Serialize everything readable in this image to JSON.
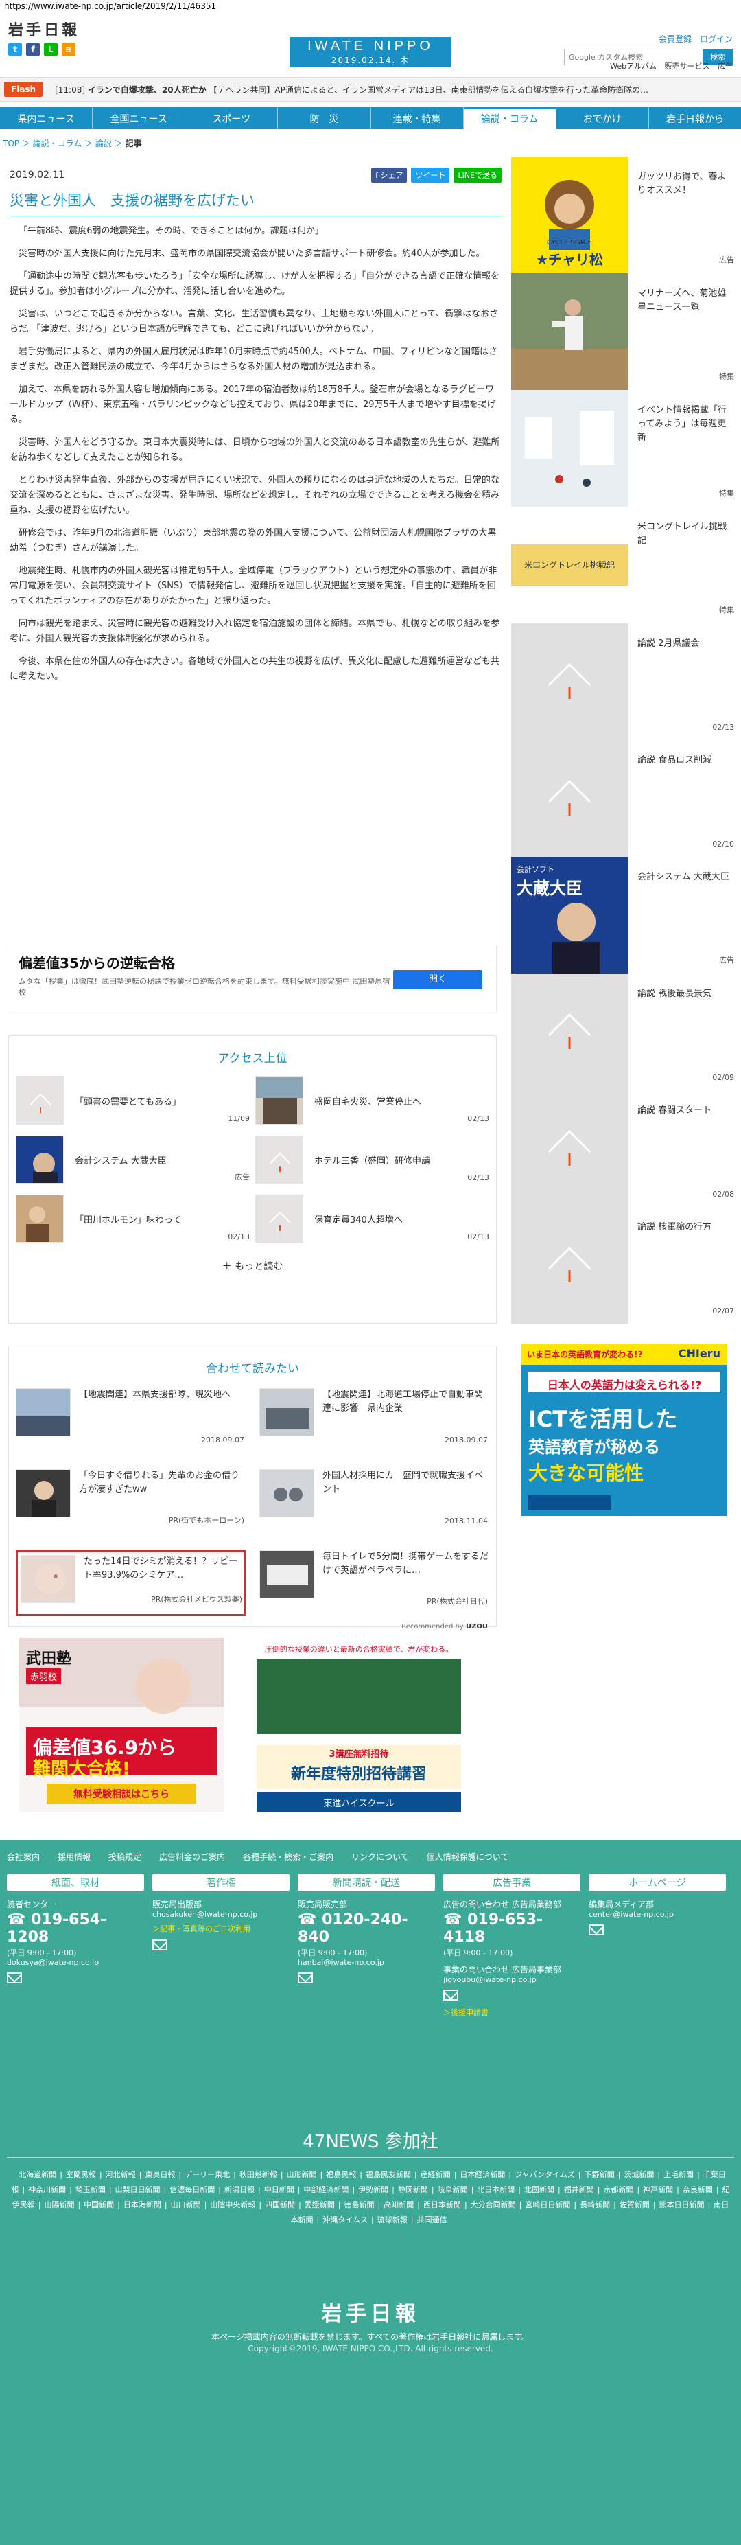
{
  "browser": {
    "url": "https://www.iwate-np.co.jp/article/2019/2/11/46351"
  },
  "header": {
    "logo_jp": "岩手日報",
    "logo_en": "IWATE NIPPO",
    "date": "2019.02.14. 木",
    "links": [
      "会員登録",
      "ログイン"
    ],
    "search_placeholder": "Google カスタム検索",
    "search_button": "検索",
    "sub_links": [
      "Webアルバム",
      "販売サービス",
      "広告"
    ]
  },
  "flash": {
    "tag": "Flash",
    "time": "[11:08]",
    "headline": "イランで自爆攻撃、20人死亡か",
    "detail": "【テヘラン共同】AP通信によると、イラン国営メディアは13日、南東部情勢を伝える自爆攻撃を行った革命防衛隊の…"
  },
  "nav": [
    {
      "label": "県内ニュース"
    },
    {
      "label": "全国ニュース"
    },
    {
      "label": "スポーツ"
    },
    {
      "label": "防　災"
    },
    {
      "label": "連載・特集"
    },
    {
      "label": "論説・コラム",
      "active": true
    },
    {
      "label": "おでかけ"
    },
    {
      "label": "岩手日報から"
    }
  ],
  "breadcrumb": {
    "path": "TOP ＞ 論説・コラム ＞ 論説 ＞",
    "current": "記事"
  },
  "article": {
    "date": "2019.02.11",
    "share_fb": "f シェア",
    "share_tw": "ツイート",
    "share_ln": "LINEで送る",
    "title": "災害と外国人　支援の裾野を広げたい",
    "paragraphs": [
      "「午前8時、震度6弱の地震発生。その時、できることは何か。課題は何か」",
      "災害時の外国人支援に向けた先月末、盛岡市の県国際交流協会が開いた多言語サポート研修会。約40人が参加した。",
      "「通勤途中の時間で観光客も歩いたろう」「安全な場所に誘導し、けが人を把握する」「自分ができる言語で正確な情報を提供する」。参加者は小グループに分かれ、活発に話し合いを進めた。",
      "災害は、いつどこで起きるか分からない。言葉、文化、生活習慣も異なり、土地勘もない外国人にとって、衝撃はなおさらだ。「津波だ、逃げろ」という日本語が理解できても、どこに逃げればいいか分からない。",
      "岩手労働局によると、県内の外国人雇用状況は昨年10月末時点で約4500人。ベトナム、中国、フィリピンなど国籍はさまざまだ。改正入管難民法の成立で、今年4月からはさらなる外国人材の増加が見込まれる。",
      "加えて、本県を訪れる外国人客も増加傾向にある。2017年の宿泊者数は約18万8千人。釜石市が会場となるラグビーワールドカップ（W杯）、東京五輪・パラリンピックなども控えており、県は20年までに、29万5千人まで増やす目標を掲げる。",
      "災害時、外国人をどう守るか。東日本大震災時には、日頃から地域の外国人と交流のある日本語教室の先生らが、避難所を訪ね歩くなどして支えたことが知られる。",
      "とりわけ災害発生直後、外部からの支援が届きにくい状況で、外国人の頼りになるのは身近な地域の人たちだ。日常的な交流を深めるとともに、さまざまな災害、発生時間、場所などを想定し、それぞれの立場でできることを考える機会を積み重ね、支援の裾野を広げたい。",
      "研修会では、昨年9月の北海道胆振（いぶり）東部地震の際の外国人支援について、公益財団法人札幌国際プラザの大黒幼希（つむぎ）さんが講演した。",
      "地震発生時、札幌市内の外国人観光客は推定約5千人。全域停電（ブラックアウト）という想定外の事態の中、職員が非常用電源を使い、会員制交流サイト（SNS）で情報発信し、避難所を巡回し状況把握と支援を実施。「自主的に避難所を回ってくれたボランティアの存在がありがたかった」と振り返った。",
      "同市は観光を踏まえ、災害時に観光客の避難受け入れ協定を宿泊施設の団体と締結。本県でも、札幌などの取り組みを参考に、外国人観光客の支援体制強化が求められる。",
      "今後、本県在住の外国人の存在は大きい。各地域で外国人との共生の視野を広げ、異文化に配慮した避難所運営なども共に考えたい。"
    ]
  },
  "ad_banner": {
    "headline": "偏差値35からの逆転合格",
    "desc": "ムダな「授業」は徹底！武田塾逆転の秘訣で授業ゼロ逆転合格を約束します。無料受験相談実施中 武田塾原宿校",
    "button": "開く"
  },
  "ranking": {
    "title": "アクセス上位",
    "items": [
      {
        "title": "「頭書の需要とてもある」",
        "date": "11/09"
      },
      {
        "title": "盛岡自宅火災、営業停止へ",
        "date": "02/13"
      },
      {
        "title": "会計システム 大蔵大臣",
        "date": "広告"
      },
      {
        "title": "ホテル三香（盛岡）研修申請",
        "date": "02/13"
      },
      {
        "title": "「田川ホルモン」味わって",
        "date": "02/13"
      },
      {
        "title": "保育定員340人超増へ",
        "date": "02/13"
      }
    ],
    "more": "＋ もっと読む"
  },
  "recommended": {
    "title": "合わせて読みたい",
    "items": [
      {
        "title": "【地震関連】本県支援部隊、現災地へ",
        "date": "2018.09.07"
      },
      {
        "title": "【地震関連】北海道工場停止で自動車関連に影響　県内企業",
        "date": "2018.09.07"
      },
      {
        "title": "「今日すぐ借りれる」先輩のお金の借り方が凄すぎたww",
        "date": "PR(街でもホーローン)"
      },
      {
        "title": "外国人材採用にカ　盛岡で就職支援イベント",
        "date": "2018.11.04"
      },
      {
        "title": "たった14日でシミが消える！？リピート率93.9%のシミケア…",
        "date": "PR(株式会社メビウス製薬)"
      },
      {
        "title": "毎日トイレで5分間！携帯ゲームをするだけで英語がペラペラに…",
        "date": "PR(株式会社日代)"
      }
    ],
    "recommended_by_label": "Recommended by",
    "recommended_by_brand": "UZOU"
  },
  "sidebar": {
    "items": [
      {
        "title": "ガッツリお得で、春よりオススメ！",
        "date": "広告"
      },
      {
        "title": "マリナーズへ、菊池雄星ニュース一覧",
        "date": "特集"
      },
      {
        "title": "イベント情報掲載「行ってみよう」は毎週更新",
        "date": "特集"
      },
      {
        "title": "米ロングトレイル挑戦記",
        "date": "特集"
      },
      {
        "title": "論説 2月県議会",
        "date": "02/13"
      },
      {
        "title": "論説 食品ロス削減",
        "date": "02/10"
      },
      {
        "title": "会計システム 大蔵大臣",
        "date": "広告"
      },
      {
        "title": "論説 戦後最長景気",
        "date": "02/09"
      },
      {
        "title": "論説 春闘スタート",
        "date": "02/08"
      },
      {
        "title": "論説 核軍縮の行方",
        "date": "02/07"
      }
    ],
    "chari_text": "★チャリ松",
    "chari_sub": "CYCLE SPACE",
    "trail_text": "米ロングトレイル挑戦記",
    "okura_text": "大蔵大臣",
    "okura_sub": "会計ソフト",
    "ad": {
      "top": "いま日本の英語教育が変わる!?",
      "brand": "CHIeru",
      "line1": "日本人の英語力は変えられる!?",
      "line2": "ICTを活用した",
      "line3": "英語教育が秘める",
      "line4": "大きな可能性"
    }
  },
  "bottom_ads": {
    "left": {
      "brand": "武田塾",
      "school": "赤羽校",
      "line1": "偏差値36.9から",
      "line2": "難関大合格!",
      "cta": "無料受験相談はこちら"
    },
    "right": {
      "top": "圧倒的な授業の違いと最新の合格実績で、君が変わる。",
      "line1": "3講座無料招待",
      "line2": "新年度特別招待講習",
      "brand": "東進ハイスクール"
    }
  },
  "footer": {
    "links": [
      "会社案内",
      "採用情報",
      "投稿規定",
      "広告料金のご案内",
      "各種手続・検索・ご案内",
      "リンクについて",
      "個人情報保護について"
    ],
    "cols": [
      {
        "head": "紙面、取材",
        "label": "読者センター",
        "phone": "019-654-1208",
        "hours": "(平日 9:00 - 17:00)",
        "mail": "dokusya@iwate-np.co.jp",
        "note": ""
      },
      {
        "head": "著作権",
        "label": "販売局出版部",
        "phone": "",
        "hours": "",
        "mail": "chosakuken@iwate-np.co.jp",
        "note": "＞記事・写真等のご二次利用"
      },
      {
        "head": "新聞購読・配送",
        "label": "販売局販売部",
        "phone": "0120-240-840",
        "hours": "(平日 9:00 - 17:00)",
        "mail": "hanbai@iwate-np.co.jp",
        "note": ""
      },
      {
        "head": "広告事業",
        "label": "広告の問い合わせ 広告局業務部",
        "phone": "019-653-4118",
        "hours": "(平日 9:00 - 17:00)",
        "mail": "jigyoubu@iwate-np.co.jp",
        "note": "＞後援申請書",
        "label2": "事業の問い合わせ 広告局事業部"
      },
      {
        "head": "ホームページ",
        "label": "編集局メディア部",
        "phone": "",
        "hours": "",
        "mail": "center@iwate-np.co.jp",
        "note": ""
      }
    ],
    "news47_title": "47NEWS 参加社",
    "papers": [
      "北海道新聞",
      "室蘭民報",
      "河北新報",
      "東奥日報",
      "デーリー東北",
      "秋田魁新報",
      "山形新聞",
      "福島民報",
      "福島民友新聞",
      "産経新聞",
      "日本経済新聞",
      "ジャパンタイムズ",
      "下野新聞",
      "茨城新聞",
      "上毛新聞",
      "千葉日報",
      "神奈川新聞",
      "埼玉新聞",
      "山梨日日新聞",
      "信濃毎日新聞",
      "新潟日報",
      "中日新聞",
      "中部経済新聞",
      "伊勢新聞",
      "静岡新聞",
      "岐阜新聞",
      "北日本新聞",
      "北國新聞",
      "福井新聞",
      "京都新聞",
      "神戸新聞",
      "奈良新聞",
      "紀伊民報",
      "山陽新聞",
      "中国新聞",
      "日本海新聞",
      "山口新聞",
      "山陰中央新報",
      "四国新聞",
      "愛媛新聞",
      "徳島新聞",
      "高知新聞",
      "西日本新聞",
      "大分合同新聞",
      "宮崎日日新聞",
      "長崎新聞",
      "佐賀新聞",
      "熊本日日新聞",
      "南日本新聞",
      "沖縄タイムス",
      "琉球新報",
      "共同通信"
    ],
    "logo": "岩手日報",
    "notice": "本ページ掲載内容の無断転載を禁じます。すべての著作権は岩手日報社に帰属します。",
    "copyright": "Copyright©2019, IWATE NIPPO CO.,LTD. All rights reserved."
  }
}
